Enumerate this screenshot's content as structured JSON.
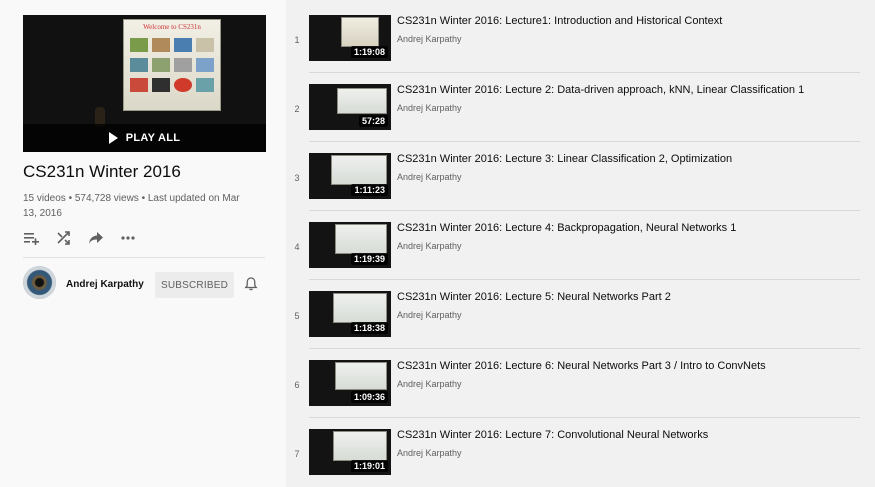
{
  "playlist": {
    "title": "CS231n Winter 2016",
    "meta": "15 videos • 574,728 views • Last updated on Mar 13, 2016",
    "play_all_label": "PLAY ALL",
    "hero_slide_title": "Welcome to CS231n",
    "actions": [
      "add-to-queue-icon",
      "shuffle-icon",
      "share-icon",
      "more-icon"
    ]
  },
  "owner": {
    "name": "Andrej Karpathy",
    "subscribe_label": "SUBSCRIBED"
  },
  "videos": [
    {
      "index": "1",
      "title": "CS231n Winter 2016: Lecture1: Introduction and Historical Context",
      "channel": "Andrej Karpathy",
      "duration": "1:19:08"
    },
    {
      "index": "2",
      "title": "CS231n Winter 2016: Lecture 2: Data-driven approach, kNN, Linear Classification 1",
      "channel": "Andrej Karpathy",
      "duration": "57:28"
    },
    {
      "index": "3",
      "title": "CS231n Winter 2016: Lecture 3: Linear Classification 2, Optimization",
      "channel": "Andrej Karpathy",
      "duration": "1:11:23"
    },
    {
      "index": "4",
      "title": "CS231n Winter 2016: Lecture 4: Backpropagation, Neural Networks 1",
      "channel": "Andrej Karpathy",
      "duration": "1:19:39"
    },
    {
      "index": "5",
      "title": "CS231n Winter 2016: Lecture 5: Neural Networks Part 2",
      "channel": "Andrej Karpathy",
      "duration": "1:18:38"
    },
    {
      "index": "6",
      "title": "CS231n Winter 2016: Lecture 6: Neural Networks Part 3 / Intro to ConvNets",
      "channel": "Andrej Karpathy",
      "duration": "1:09:36"
    },
    {
      "index": "7",
      "title": "CS231n Winter 2016: Lecture 7: Convolutional Neural Networks",
      "channel": "Andrej Karpathy",
      "duration": "1:19:01"
    }
  ],
  "colors": {
    "sidebar_bg": "#f9f9f9",
    "list_bg": "#f1f1f1",
    "secondary_text": "#606060",
    "subscribed_bg": "#ececec"
  }
}
